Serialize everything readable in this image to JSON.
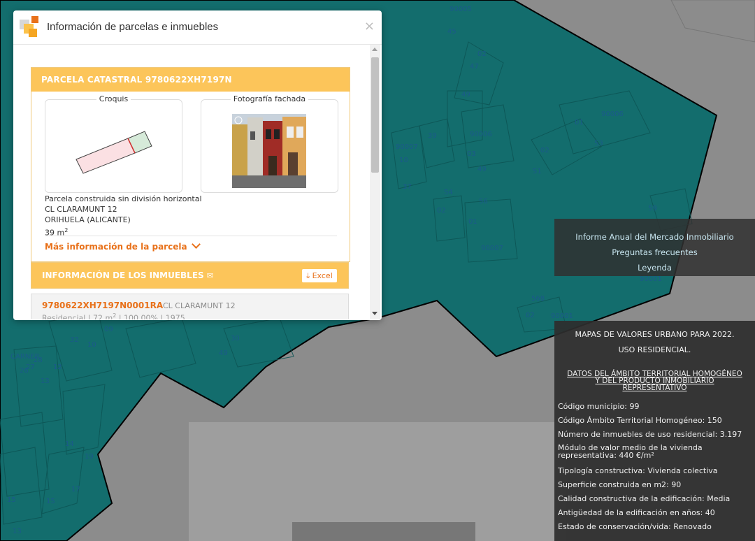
{
  "dialog": {
    "title": "Información de parcelas e inmuebles",
    "close": "×"
  },
  "parcel": {
    "header": "PARCELA CATASTRAL 9780622XH7197N",
    "croquis_label": "Croquis",
    "foto_label": "Fotografía fachada",
    "address_lines": [
      "Parcela construida sin división horizontal",
      "CL CLARAMUNT 12",
      "ORIHUELA (ALICANTE)"
    ],
    "area": "39 m",
    "area_sup": "2",
    "more_info": "Más información de la parcela"
  },
  "inmuebles": {
    "header": "INFORMACIÓN DE LOS INMUEBLES",
    "excel": "Excel",
    "items": [
      {
        "ref": "9780622XH7197N0001RA",
        "address": "CL CLARAMUNT 12",
        "use": "Residencial",
        "area": "72 m",
        "area_sup": "2",
        "share": "100,00%",
        "year": "1975"
      }
    ]
  },
  "links": [
    "Informe Anual del Mercado Inmobiliario",
    "Preguntas frecuentes",
    "Leyenda"
  ],
  "info": {
    "title1": "MAPAS DE VALORES URBANO PARA 2022.",
    "title2": "USO RESIDENCIAL.",
    "subtitle_lines": [
      "DATOS DEL ÁMBITO TERRITORIAL HOMOGÉNEO",
      "Y DEL PRODUCTO INMOBILIARIO",
      "REPRESENTATIVO"
    ],
    "lines": [
      "Código municipio: 99",
      "Código Ámbito Territorial Homogéneo: 150",
      "Número de inmuebles de uso residencial: 3.197",
      "Módulo de valor medio de la vivienda",
      "representativa: 440 €/m²",
      "Tipología constructiva: Vivienda colectiva",
      "Superficie construida en m2: 90",
      "Calidad constructiva de la edificación: Media",
      "Antigüedad de la edificación en años: 40",
      "Estado de conservación/vida: Renovado"
    ]
  },
  "map_labels": [
    "90005",
    "45",
    "02",
    "47",
    "49",
    "39",
    "59",
    "90006",
    "90007",
    "10",
    "37",
    "03",
    "49",
    "51",
    "53",
    "01",
    "90006",
    "02",
    "59",
    "54",
    "01",
    "02",
    "56",
    "90007",
    "568",
    "02",
    "90001",
    "90001",
    "49",
    "30",
    "32",
    "10",
    "09",
    "CARNER",
    "28",
    "27",
    "26",
    "13",
    "12",
    "14",
    "19",
    "17",
    "15",
    "15",
    "13"
  ],
  "colors": {
    "teal": "#136d6d",
    "accent": "#e8711a",
    "header": "#fcc55a"
  }
}
